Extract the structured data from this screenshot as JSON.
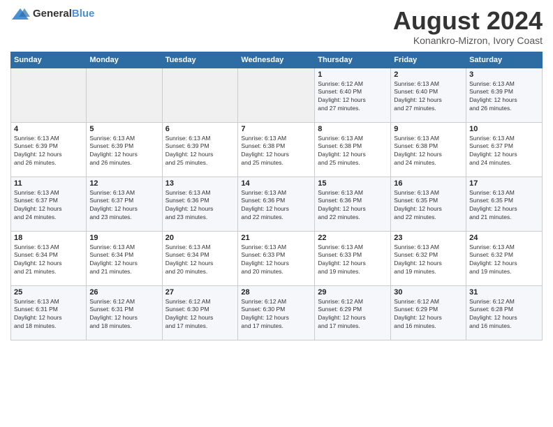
{
  "header": {
    "logo_general": "General",
    "logo_blue": "Blue",
    "month_year": "August 2024",
    "location": "Konankro-Mizron, Ivory Coast"
  },
  "days_of_week": [
    "Sunday",
    "Monday",
    "Tuesday",
    "Wednesday",
    "Thursday",
    "Friday",
    "Saturday"
  ],
  "weeks": [
    [
      {
        "day": "",
        "info": ""
      },
      {
        "day": "",
        "info": ""
      },
      {
        "day": "",
        "info": ""
      },
      {
        "day": "",
        "info": ""
      },
      {
        "day": "1",
        "info": "Sunrise: 6:12 AM\nSunset: 6:40 PM\nDaylight: 12 hours\nand 27 minutes."
      },
      {
        "day": "2",
        "info": "Sunrise: 6:13 AM\nSunset: 6:40 PM\nDaylight: 12 hours\nand 27 minutes."
      },
      {
        "day": "3",
        "info": "Sunrise: 6:13 AM\nSunset: 6:39 PM\nDaylight: 12 hours\nand 26 minutes."
      }
    ],
    [
      {
        "day": "4",
        "info": "Sunrise: 6:13 AM\nSunset: 6:39 PM\nDaylight: 12 hours\nand 26 minutes."
      },
      {
        "day": "5",
        "info": "Sunrise: 6:13 AM\nSunset: 6:39 PM\nDaylight: 12 hours\nand 26 minutes."
      },
      {
        "day": "6",
        "info": "Sunrise: 6:13 AM\nSunset: 6:39 PM\nDaylight: 12 hours\nand 25 minutes."
      },
      {
        "day": "7",
        "info": "Sunrise: 6:13 AM\nSunset: 6:38 PM\nDaylight: 12 hours\nand 25 minutes."
      },
      {
        "day": "8",
        "info": "Sunrise: 6:13 AM\nSunset: 6:38 PM\nDaylight: 12 hours\nand 25 minutes."
      },
      {
        "day": "9",
        "info": "Sunrise: 6:13 AM\nSunset: 6:38 PM\nDaylight: 12 hours\nand 24 minutes."
      },
      {
        "day": "10",
        "info": "Sunrise: 6:13 AM\nSunset: 6:37 PM\nDaylight: 12 hours\nand 24 minutes."
      }
    ],
    [
      {
        "day": "11",
        "info": "Sunrise: 6:13 AM\nSunset: 6:37 PM\nDaylight: 12 hours\nand 24 minutes."
      },
      {
        "day": "12",
        "info": "Sunrise: 6:13 AM\nSunset: 6:37 PM\nDaylight: 12 hours\nand 23 minutes."
      },
      {
        "day": "13",
        "info": "Sunrise: 6:13 AM\nSunset: 6:36 PM\nDaylight: 12 hours\nand 23 minutes."
      },
      {
        "day": "14",
        "info": "Sunrise: 6:13 AM\nSunset: 6:36 PM\nDaylight: 12 hours\nand 22 minutes."
      },
      {
        "day": "15",
        "info": "Sunrise: 6:13 AM\nSunset: 6:36 PM\nDaylight: 12 hours\nand 22 minutes."
      },
      {
        "day": "16",
        "info": "Sunrise: 6:13 AM\nSunset: 6:35 PM\nDaylight: 12 hours\nand 22 minutes."
      },
      {
        "day": "17",
        "info": "Sunrise: 6:13 AM\nSunset: 6:35 PM\nDaylight: 12 hours\nand 21 minutes."
      }
    ],
    [
      {
        "day": "18",
        "info": "Sunrise: 6:13 AM\nSunset: 6:34 PM\nDaylight: 12 hours\nand 21 minutes."
      },
      {
        "day": "19",
        "info": "Sunrise: 6:13 AM\nSunset: 6:34 PM\nDaylight: 12 hours\nand 21 minutes."
      },
      {
        "day": "20",
        "info": "Sunrise: 6:13 AM\nSunset: 6:34 PM\nDaylight: 12 hours\nand 20 minutes."
      },
      {
        "day": "21",
        "info": "Sunrise: 6:13 AM\nSunset: 6:33 PM\nDaylight: 12 hours\nand 20 minutes."
      },
      {
        "day": "22",
        "info": "Sunrise: 6:13 AM\nSunset: 6:33 PM\nDaylight: 12 hours\nand 19 minutes."
      },
      {
        "day": "23",
        "info": "Sunrise: 6:13 AM\nSunset: 6:32 PM\nDaylight: 12 hours\nand 19 minutes."
      },
      {
        "day": "24",
        "info": "Sunrise: 6:13 AM\nSunset: 6:32 PM\nDaylight: 12 hours\nand 19 minutes."
      }
    ],
    [
      {
        "day": "25",
        "info": "Sunrise: 6:13 AM\nSunset: 6:31 PM\nDaylight: 12 hours\nand 18 minutes."
      },
      {
        "day": "26",
        "info": "Sunrise: 6:12 AM\nSunset: 6:31 PM\nDaylight: 12 hours\nand 18 minutes."
      },
      {
        "day": "27",
        "info": "Sunrise: 6:12 AM\nSunset: 6:30 PM\nDaylight: 12 hours\nand 17 minutes."
      },
      {
        "day": "28",
        "info": "Sunrise: 6:12 AM\nSunset: 6:30 PM\nDaylight: 12 hours\nand 17 minutes."
      },
      {
        "day": "29",
        "info": "Sunrise: 6:12 AM\nSunset: 6:29 PM\nDaylight: 12 hours\nand 17 minutes."
      },
      {
        "day": "30",
        "info": "Sunrise: 6:12 AM\nSunset: 6:29 PM\nDaylight: 12 hours\nand 16 minutes."
      },
      {
        "day": "31",
        "info": "Sunrise: 6:12 AM\nSunset: 6:28 PM\nDaylight: 12 hours\nand 16 minutes."
      }
    ]
  ]
}
